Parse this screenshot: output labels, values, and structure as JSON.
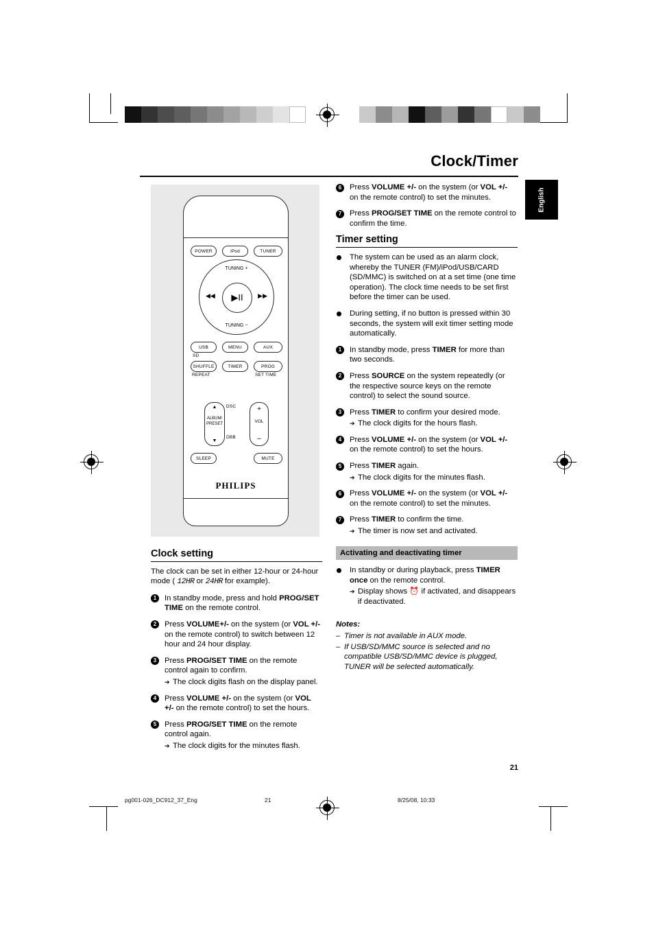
{
  "header": {
    "chapter_title": "Clock/Timer",
    "language_tab": "English"
  },
  "page_number": "21",
  "footer": {
    "file": "pg001-026_DC912_37_Eng",
    "page": "21",
    "date": "8/25/08, 10:33"
  },
  "remote": {
    "brand": "PHILIPS",
    "buttons": {
      "power": "POWER",
      "ipod": "iPod",
      "tuner": "TUNER",
      "tuning_up": "TUNING",
      "tuning_down": "TUNING",
      "prev": "◀◀",
      "play_pause": "▶II",
      "next": "▶▶",
      "usb": "USB",
      "menu": "MENU",
      "aux": "AUX",
      "sd": "SD",
      "shuffle": "SHUFFLE",
      "timer": "TIMER",
      "prog": "PROG",
      "repeat": "REPEAT",
      "set_time": "SET TIME",
      "dsc": "DSC",
      "dbb": "DBB",
      "album_preset": "ALBUM/\nPRESET",
      "album_up": "▲",
      "album_down": "▼",
      "vol_plus": "+",
      "vol_label": "VOL",
      "vol_minus": "–",
      "sleep": "SLEEP",
      "mute": "MUTE"
    }
  },
  "clock_setting": {
    "title": "Clock setting",
    "intro_a": "The clock can be set in either 12-hour or 24-hour mode ( ",
    "intro_seg1": "12HR",
    "intro_b": " or ",
    "intro_seg2": "24HR",
    "intro_c": " for example).",
    "steps": [
      {
        "num": "1",
        "parts": [
          {
            "t": "In standby mode, press and hold "
          },
          {
            "t": "PROG/SET TIME",
            "b": true
          },
          {
            "t": " on the remote control."
          }
        ]
      },
      {
        "num": "2",
        "parts": [
          {
            "t": "Press "
          },
          {
            "t": "VOLUME+/-",
            "b": true
          },
          {
            "t": " on the system (or "
          },
          {
            "t": "VOL  +/-",
            "b": true
          },
          {
            "t": " on the remote control) to switch between 12 hour and 24 hour display."
          }
        ]
      },
      {
        "num": "3",
        "parts": [
          {
            "t": "Press "
          },
          {
            "t": "PROG/SET TIME",
            "b": true
          },
          {
            "t": " on the remote control again to confirm."
          }
        ],
        "result": "The clock digits flash on the display panel."
      },
      {
        "num": "4",
        "parts": [
          {
            "t": "Press "
          },
          {
            "t": "VOLUME +/-",
            "b": true
          },
          {
            "t": " on the system (or "
          },
          {
            "t": "VOL  +/-",
            "b": true
          },
          {
            "t": " on the remote control) to set the hours."
          }
        ]
      },
      {
        "num": "5",
        "parts": [
          {
            "t": "Press "
          },
          {
            "t": "PROG/SET TIME",
            "b": true
          },
          {
            "t": " on the remote control again."
          }
        ],
        "result": "The clock digits for the minutes flash."
      }
    ]
  },
  "clock_setting_cont": {
    "steps": [
      {
        "num": "6",
        "parts": [
          {
            "t": "Press "
          },
          {
            "t": "VOLUME +/-",
            "b": true
          },
          {
            "t": " on the system (or "
          },
          {
            "t": "VOL  +/-",
            "b": true
          },
          {
            "t": " on the remote control) to set the minutes."
          }
        ]
      },
      {
        "num": "7",
        "parts": [
          {
            "t": "Press "
          },
          {
            "t": "PROG/SET TIME",
            "b": true
          },
          {
            "t": "  on the remote control to confirm the time."
          }
        ]
      }
    ]
  },
  "timer_setting": {
    "title": "Timer setting",
    "bullets": [
      "The system can be used as an alarm clock, whereby the TUNER (FM)/iPod/USB/CARD (SD/MMC) is switched on at a set time (one time operation). The clock time needs to be set first before the timer can be used.",
      "During setting, if no button is pressed within 30 seconds, the system will exit timer setting mode automatically."
    ],
    "steps": [
      {
        "num": "1",
        "parts": [
          {
            "t": "In standby mode, press "
          },
          {
            "t": "TIMER",
            "b": true
          },
          {
            "t": " for more than two seconds."
          }
        ]
      },
      {
        "num": "2",
        "parts": [
          {
            "t": "Press "
          },
          {
            "t": "SOURCE",
            "b": true
          },
          {
            "t": " on the system repeatedly (or the respective source keys on the remote control) to select the sound source."
          }
        ]
      },
      {
        "num": "3",
        "parts": [
          {
            "t": "Press "
          },
          {
            "t": "TIMER",
            "b": true
          },
          {
            "t": " to confirm your desired mode."
          }
        ],
        "result": "The clock digits for the hours flash."
      },
      {
        "num": "4",
        "parts": [
          {
            "t": "Press "
          },
          {
            "t": "VOLUME +/-",
            "b": true
          },
          {
            "t": " on the system (or "
          },
          {
            "t": "VOL  +/-",
            "b": true
          },
          {
            "t": " on the remote control) to set the hours."
          }
        ]
      },
      {
        "num": "5",
        "parts": [
          {
            "t": "Press "
          },
          {
            "t": "TIMER",
            "b": true
          },
          {
            "t": " again."
          }
        ],
        "result": "The clock digits for the minutes flash."
      },
      {
        "num": "6",
        "parts": [
          {
            "t": "Press "
          },
          {
            "t": "VOLUME +/-",
            "b": true
          },
          {
            "t": " on the system (or "
          },
          {
            "t": "VOL  +/-",
            "b": true
          },
          {
            "t": " on the remote control) to set the minutes."
          }
        ]
      },
      {
        "num": "7",
        "parts": [
          {
            "t": "Press "
          },
          {
            "t": "TIMER",
            "b": true
          },
          {
            "t": " to confirm the time."
          }
        ],
        "result": "The timer is now set and activated."
      }
    ]
  },
  "activating": {
    "banner": "Activating and deactivating timer",
    "bullet_parts": [
      {
        "t": "In standby or during playback, press "
      },
      {
        "t": "TIMER once",
        "b": true
      },
      {
        "t": " on the remote control."
      }
    ],
    "result_a": "Display shows ",
    "result_icon": "⏰",
    "result_b": " if activated, and disappears if deactivated."
  },
  "notes": {
    "title": "Notes:",
    "lines": [
      "Timer is not available in  AUX mode.",
      "If USB/SD/MMC source is selected and no compatible USB/SD/MMC device is plugged, TUNER will be selected automatically."
    ]
  },
  "colors": {
    "banner_bg": "#b9b9b9",
    "illustration_bg": "#e9e9e9",
    "ink": "#000000"
  }
}
